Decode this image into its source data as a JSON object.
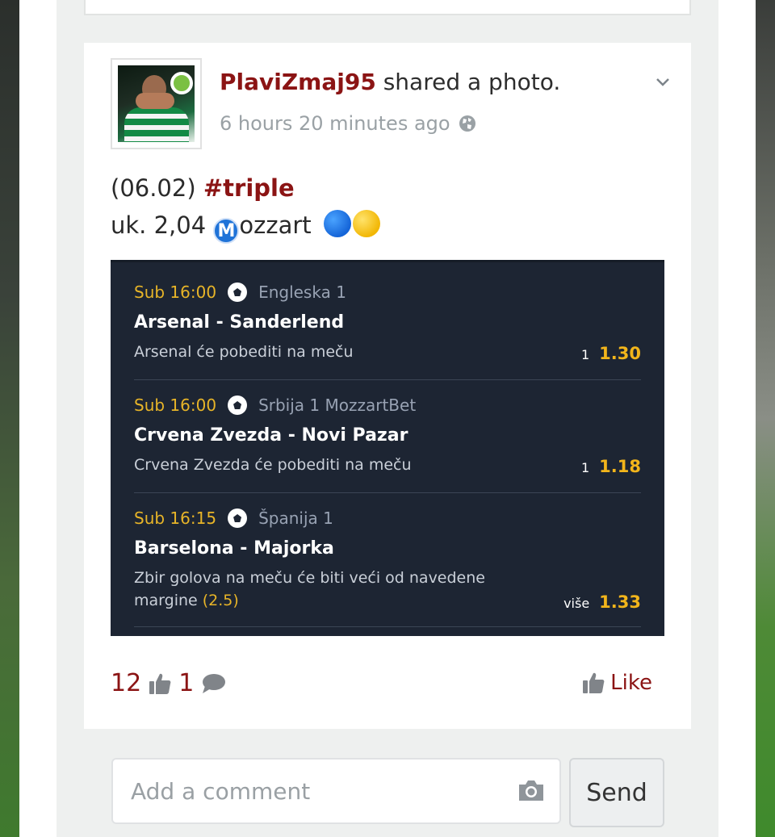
{
  "post": {
    "author": "PlaviZmaj95",
    "action": " shared a photo.",
    "timestamp": "6 hours 20 minutes ago",
    "visibility_icon": "globe-icon",
    "text_line1_prefix": "(06.02) ",
    "hashtag": "#triple",
    "text_line2_prefix": "uk. 2,04 ",
    "text_line2_metro": "M",
    "text_line2_suffix": "ozzart"
  },
  "ticket": {
    "matches": [
      {
        "time": "Sub 16:00",
        "league": "Engleska 1",
        "teams": "Arsenal - Sanderlend",
        "desc": "Arsenal će pobediti na meču",
        "desc_highlight": "",
        "selection": "1",
        "odds": "1.30"
      },
      {
        "time": "Sub 16:00",
        "league": "Srbija 1 MozzartBet",
        "teams": "Crvena Zvezda - Novi Pazar",
        "desc": "Crvena Zvezda će pobediti na meču",
        "desc_highlight": "",
        "selection": "1",
        "odds": "1.18"
      },
      {
        "time": "Sub 16:15",
        "league": "Španija 1",
        "teams": "Barselona - Majorka",
        "desc": "Zbir golova na meču će biti veći od navedene margine ",
        "desc_highlight": "(2.5)",
        "selection": "više",
        "odds": "1.33"
      }
    ]
  },
  "stats": {
    "likes": "12",
    "comments": "1",
    "like_label": "Like"
  },
  "comment": {
    "placeholder": "Add a comment",
    "send_label": "Send"
  },
  "colors": {
    "brand": "#8b1414",
    "ticket_bg": "#1d2533",
    "ticket_accent": "#f2b51b",
    "online": "#7bc043"
  }
}
